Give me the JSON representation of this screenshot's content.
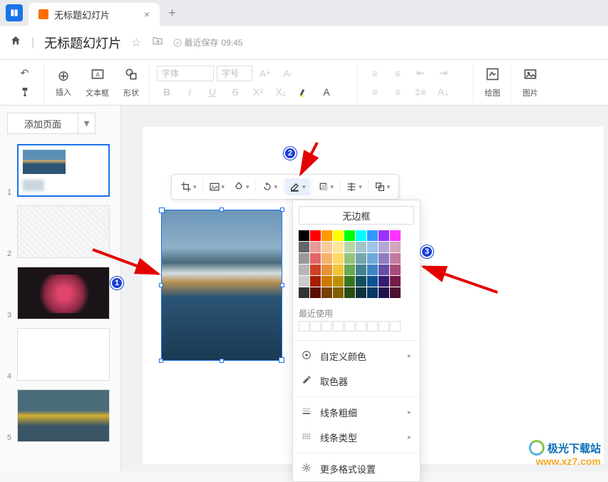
{
  "titlebar": {
    "tab_title": "无标题幻灯片"
  },
  "docheader": {
    "title": "无标题幻灯片",
    "save_status_prefix": "最近保存",
    "save_time": "09:45"
  },
  "toolbar": {
    "insert_label": "插入",
    "textbox_label": "文本框",
    "shape_label": "形状",
    "font_placeholder": "字体",
    "size_placeholder": "字号",
    "draw_label": "绘图",
    "image_label": "图片"
  },
  "sidebar": {
    "add_page_label": "添加页面",
    "slides": [
      {
        "num": "1"
      },
      {
        "num": "2"
      },
      {
        "num": "3"
      },
      {
        "num": "4"
      },
      {
        "num": "5"
      }
    ]
  },
  "dropdown": {
    "no_border": "无边框",
    "recent_label": "最近使用",
    "custom_color": "自定义颜色",
    "eyedropper": "取色器",
    "line_weight": "线条粗细",
    "line_style": "线条类型",
    "more_format": "更多格式设置",
    "color_rows": [
      [
        "#000000",
        "#ff0000",
        "#ff9900",
        "#ffff00",
        "#00ff00",
        "#00ffff",
        "#3399ff",
        "#9933ff",
        "#ff33ff"
      ],
      [
        "#666666",
        "#ea9999",
        "#f9cb9c",
        "#ffe599",
        "#b6d7a8",
        "#a2c4c9",
        "#9fc5e8",
        "#b4a7d6",
        "#d5a6bd"
      ],
      [
        "#999999",
        "#e06666",
        "#f6b26b",
        "#ffd966",
        "#93c47d",
        "#76a5af",
        "#6fa8dc",
        "#8e7cc3",
        "#c27ba0"
      ],
      [
        "#b7b7b7",
        "#cc4125",
        "#e69138",
        "#f1c232",
        "#6aa84f",
        "#45818e",
        "#3d85c6",
        "#674ea7",
        "#a64d79"
      ],
      [
        "#cccccc",
        "#a61c00",
        "#cc7a00",
        "#bf9000",
        "#38761d",
        "#134f5c",
        "#0b5394",
        "#351c75",
        "#741b47"
      ],
      [
        "#333333",
        "#5b0f00",
        "#783f04",
        "#7f6000",
        "#274e13",
        "#0c343d",
        "#073763",
        "#20124d",
        "#4c1130"
      ]
    ]
  },
  "watermark": {
    "name": "极光下载站",
    "url": "www.xz7.com"
  },
  "annotations": {
    "marker1": "1",
    "marker2": "2",
    "marker3": "3"
  }
}
